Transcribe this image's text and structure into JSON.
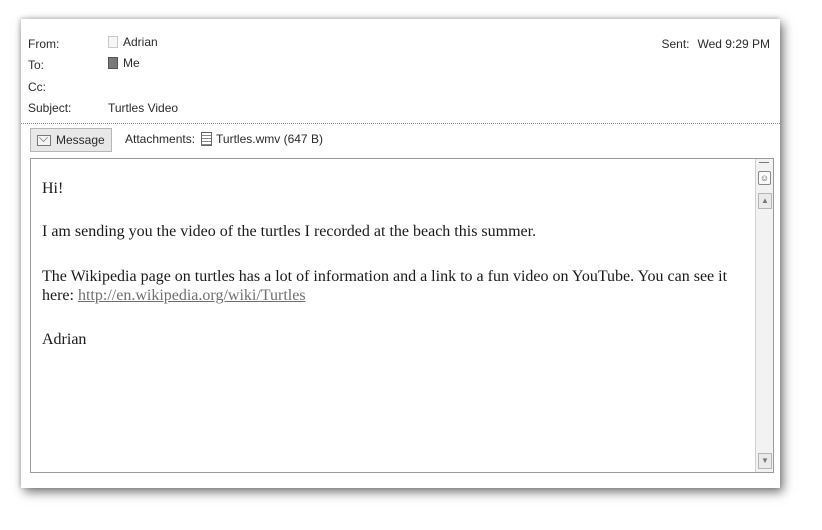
{
  "header": {
    "from_label": "From:",
    "from_value": "Adrian",
    "to_label": "To:",
    "to_value": "Me",
    "cc_label": "Cc:",
    "subject_label": "Subject:",
    "subject_value": "Turtles Video",
    "sent_label": "Sent:",
    "sent_value": "Wed 9:29 PM"
  },
  "tabs": {
    "message_label": "Message",
    "attachments_label": "Attachments:",
    "attachment_file": "Turtles.wmv (647 B)"
  },
  "body": {
    "greeting": "Hi!",
    "intro": "I am sending you the video of the turtles I recorded at the beach this summer.",
    "wiki_text": "The Wikipedia page on turtles has a lot of information and a link to a fun video on YouTube. You can see it here: ",
    "link": "http://en.wikipedia.org/wiki/Turtles",
    "signature": "Adrian"
  },
  "icons": {
    "scroll_up": "up-arrow-icon",
    "scroll_down": "down-arrow-icon"
  }
}
